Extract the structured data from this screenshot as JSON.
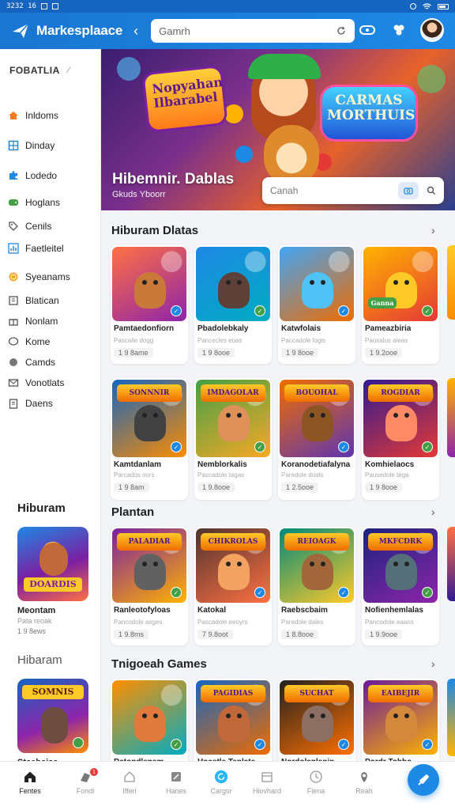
{
  "status_bar": {
    "left": "3232 16",
    "icons": [
      "notification-icon",
      "message-icon",
      "alarm-icon",
      "wifi-icon",
      "battery-icon"
    ]
  },
  "header": {
    "brand": "Markesplaace",
    "search_placeholder": "Gamrh",
    "accent": "#1976d2"
  },
  "sidebar": {
    "title": "FOBATLIA",
    "items": [
      {
        "label": "Inldoms",
        "icon": "home-icon",
        "color": "#ff7a1a"
      },
      {
        "label": "Dinday",
        "icon": "grid-icon",
        "color": "#1e88e5"
      },
      {
        "label": "Lodedo",
        "icon": "puzzle-icon",
        "color": "#1e88e5"
      },
      {
        "label": "Hoglans",
        "icon": "controller-icon",
        "color": "#43a047"
      },
      {
        "label": "Cenils",
        "icon": "tag-icon",
        "color": "#555"
      },
      {
        "label": "Faetleitel",
        "icon": "chart-icon",
        "color": "#1e88e5"
      },
      {
        "label": "Syeanams",
        "icon": "coin-icon",
        "color": "#f9a825"
      },
      {
        "label": "Blatican",
        "icon": "book-icon",
        "color": "#555"
      },
      {
        "label": "Nonlam",
        "icon": "gift-icon",
        "color": "#555"
      },
      {
        "label": "Kome",
        "icon": "chat-icon",
        "color": "#555"
      },
      {
        "label": "Camds",
        "icon": "circle-icon",
        "color": "#555"
      },
      {
        "label": "Vonotlats",
        "icon": "mail-icon",
        "color": "#555"
      },
      {
        "label": "Daens",
        "icon": "clipboard-icon",
        "color": "#555"
      }
    ],
    "section1": {
      "title": "Hiburam",
      "card_title": "DOARDIS",
      "name": "Meontam",
      "sub": "Pata reoak",
      "price": "1 9 8ews"
    },
    "section2": {
      "title": "Hibaram",
      "card_title": "SOMNIS",
      "name": "Staehaiss"
    }
  },
  "banner": {
    "logo_left": "Nopyahan Ilbarabel",
    "logo_right": "CARMAS MORTHUIS",
    "title": "Hibemnir. Dablas",
    "subtitle": "Gkuds Yboorr",
    "search_placeholder": "Canah"
  },
  "sections": [
    {
      "title": "Hiburam Dlatas",
      "cards": [
        {
          "name": "Pamtaedonfiorn",
          "sub": "Pascaile dogg",
          "price": "1 9 8ame",
          "banner": "",
          "bg1": "#ff7043",
          "bg2": "#8e24aa",
          "char": "#c97a3b",
          "badge": "#1e88e5"
        },
        {
          "name": "Pbadolebkaly",
          "sub": "Pancecles eoas",
          "price": "1 9 8ooe",
          "banner": "",
          "bg1": "#1e88e5",
          "bg2": "#00acc1",
          "char": "#5d4037",
          "badge": "#43a047"
        },
        {
          "name": "Katwfolais",
          "sub": "Paccadole logis",
          "price": "1 9 8ooe",
          "banner": "",
          "bg1": "#42a5f5",
          "bg2": "#ef6c00",
          "char": "#4fc3f7",
          "badge": "#1e88e5"
        },
        {
          "name": "Pameazbiria",
          "sub": "Paoxalus aieas",
          "price": "1 9.2ooe",
          "banner": "Ganna",
          "bg1": "#ffb300",
          "bg2": "#e53935",
          "char": "#ffca28",
          "badge": "#43a047"
        }
      ]
    },
    {
      "title": "",
      "cards": [
        {
          "name": "Kamtdanlam",
          "sub": "Parcados oors",
          "price": "1 9 8am",
          "banner": "SONNNIR",
          "bg1": "#1565c0",
          "bg2": "#fb8c00",
          "char": "#424242",
          "badge": "#1e88e5"
        },
        {
          "name": "Nemblorkalis",
          "sub": "Pascadole tagas",
          "price": "1 9.8ooe",
          "banner": "IMDAGOLAR",
          "bg1": "#43a047",
          "bg2": "#f9a825",
          "char": "#e0915a",
          "badge": "#43a047"
        },
        {
          "name": "Koranodetiafalyna",
          "sub": "Paredole doals",
          "price": "1 2.5ooe",
          "banner": "BOUOHAL",
          "bg1": "#ef6c00",
          "bg2": "#5e35b1",
          "char": "#8d5524",
          "badge": "#1e88e5"
        },
        {
          "name": "Komhielaocs",
          "sub": "Pausedole tega",
          "price": "1 9 8ooe",
          "banner": "ROGDIAR",
          "bg1": "#311b92",
          "bg2": "#e53935",
          "char": "#ff8a65",
          "badge": "#43a047"
        }
      ]
    },
    {
      "title": "Plantan",
      "cards": [
        {
          "name": "Ranleotofyloas",
          "sub": "Pancodole asges",
          "price": "1 9.8ms",
          "banner": "PALADIAR",
          "bg1": "#7b1fa2",
          "bg2": "#ffb300",
          "char": "#616161",
          "badge": "#43a047"
        },
        {
          "name": "Katokal",
          "sub": "Pascadole eeoyrs",
          "price": "7 9.8oot",
          "banner": "CHIKROLAS",
          "bg1": "#4e342e",
          "bg2": "#ff7043",
          "char": "#f4a261",
          "badge": "#1e88e5"
        },
        {
          "name": "Raebscbaim",
          "sub": "Paredole dales",
          "price": "1 8.8ooe",
          "banner": "REIOAGK",
          "bg1": "#00897b",
          "bg2": "#ffca28",
          "char": "#a1673a",
          "badge": "#1e88e5"
        },
        {
          "name": "Nofienhemlalas",
          "sub": "Pancodole eaans",
          "price": "1 9.9ooe",
          "banner": "MKFCDRK",
          "bg1": "#1a237e",
          "bg2": "#8e24aa",
          "char": "#546e7a",
          "badge": "#43a047"
        }
      ]
    },
    {
      "title": "Tnigoeah Games",
      "cards": [
        {
          "name": "Ratondlenam",
          "sub": "",
          "price": "",
          "banner": "",
          "bg1": "#ff8f00",
          "bg2": "#00acc1",
          "char": "#e07a3c",
          "badge": "#43a047"
        },
        {
          "name": "Hoastle Tenlate",
          "sub": "",
          "price": "",
          "banner": "PAGIDIAS",
          "bg1": "#1565c0",
          "bg2": "#ef6c00",
          "char": "#c1693a",
          "badge": "#1e88e5"
        },
        {
          "name": "Nordolanlanin",
          "sub": "",
          "price": "",
          "banner": "SUCHAT",
          "bg1": "#212121",
          "bg2": "#ff6f00",
          "char": "#8d6e63",
          "badge": "#1e88e5"
        },
        {
          "name": "Pordr Tobbo",
          "sub": "",
          "price": "",
          "banner": "EAIBEJIR",
          "bg1": "#6a1b9a",
          "bg2": "#ffb300",
          "char": "#d4883c",
          "badge": "#1e88e5"
        }
      ]
    }
  ],
  "bottom_nav": [
    {
      "label": "Fentes",
      "icon": "home-icon",
      "active": true
    },
    {
      "label": "Fondi",
      "icon": "game-icon",
      "badge": "1"
    },
    {
      "label": "Ifferi",
      "icon": "house-outline-icon"
    },
    {
      "label": "Hanes",
      "icon": "edit-icon"
    },
    {
      "label": "Cargsr",
      "icon": "refresh-icon"
    },
    {
      "label": "Hiovhard",
      "icon": "store-icon"
    },
    {
      "label": "Fiena",
      "icon": "clock-icon"
    },
    {
      "label": "Reah",
      "icon": "location-icon"
    }
  ],
  "fab": {
    "icon": "rocket-icon"
  }
}
